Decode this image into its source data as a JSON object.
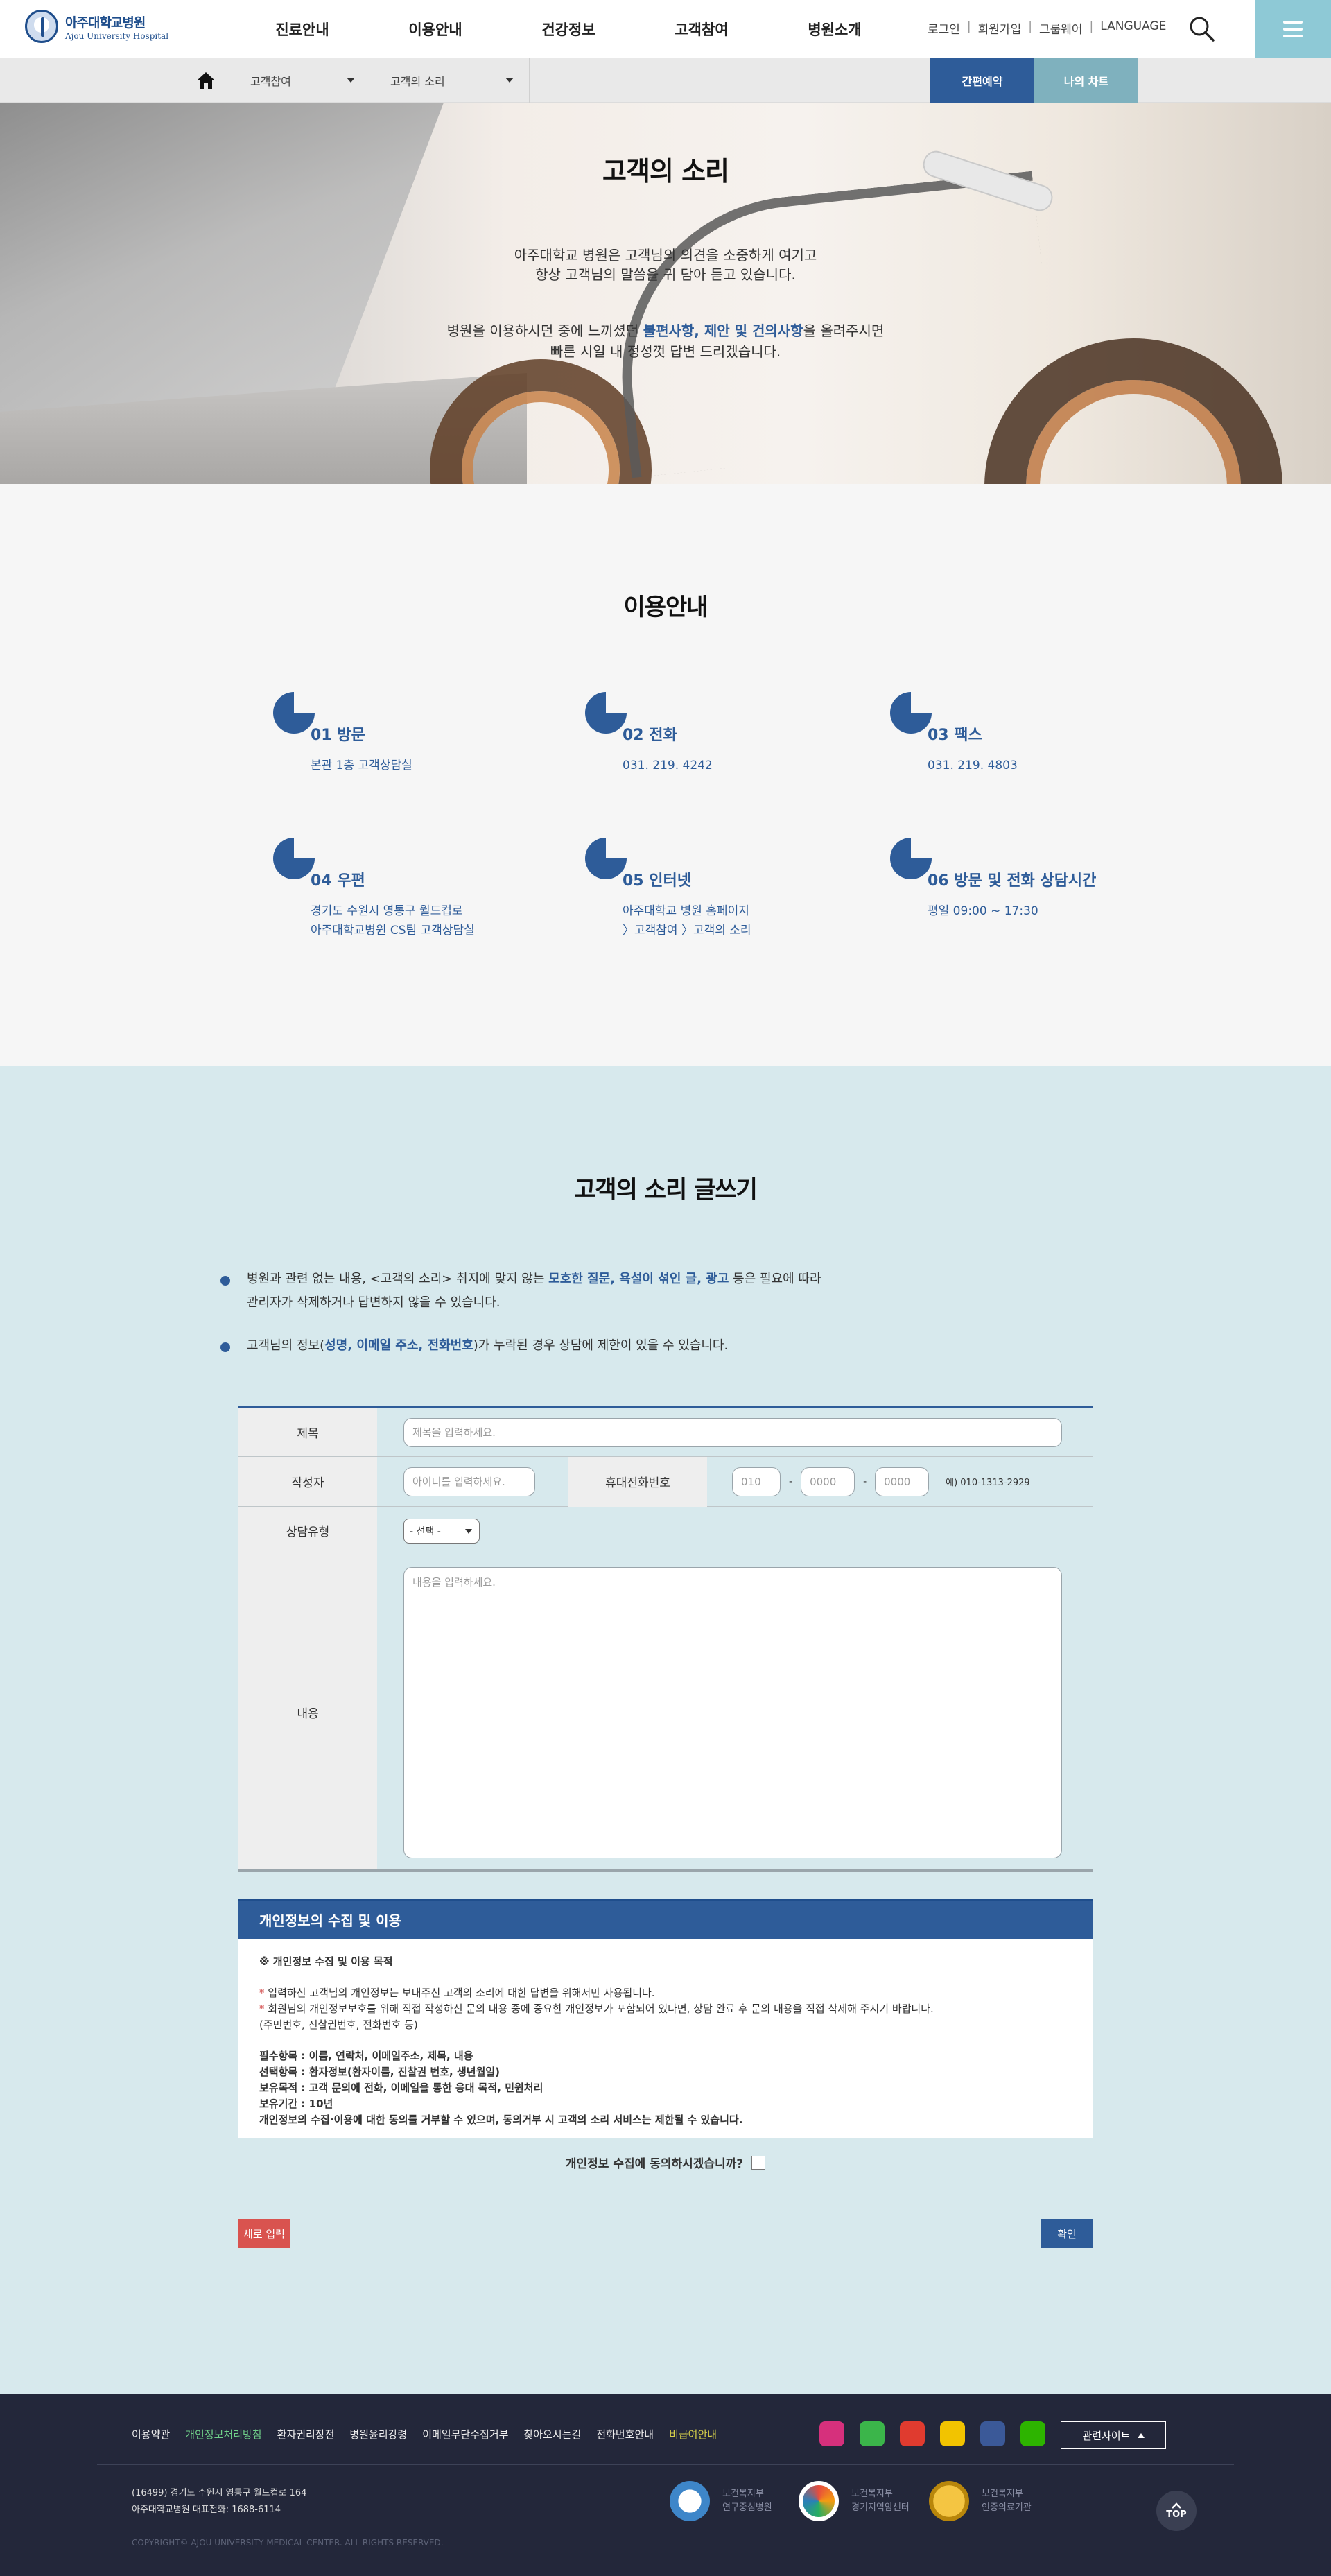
{
  "header": {
    "logo_ko": "아주대학교병원",
    "logo_en": "Ajou University Hospital",
    "gnb": [
      "진료안내",
      "이용안내",
      "건강정보",
      "고객참여",
      "병원소개"
    ],
    "util": [
      "로그인",
      "회원가입",
      "그룹웨어",
      "LANGUAGE"
    ]
  },
  "subbar": {
    "crumb1": "고객참여",
    "crumb2": "고객의 소리",
    "quick_btn": "간편예약",
    "chart_btn": "나의 차트"
  },
  "hero": {
    "title": "고객의 소리",
    "p1_line1": "아주대학교 병원은 고객님의 의견을 소중하게 여기고",
    "p1_line2": "항상 고객님의 말씀을 귀 담아 듣고 있습니다.",
    "p2_pre": "병원을 이용하시던 중에 느끼셨던 ",
    "p2_hl": "불편사항, 제안 및 건의사항",
    "p2_post": "을 올려주시면",
    "p2_line2": "빠른 시일 내 정성껏 답변 드리겠습니다."
  },
  "usage": {
    "title": "이용안내",
    "items": [
      {
        "title": "01 방문",
        "desc1": "본관 1층 고객상담실",
        "desc2": ""
      },
      {
        "title": "02 전화",
        "desc1": "031. 219. 4242",
        "desc2": ""
      },
      {
        "title": "03 팩스",
        "desc1": "031. 219. 4803",
        "desc2": ""
      },
      {
        "title": "04 우편",
        "desc1": "경기도 수원시 영통구 월드컵로",
        "desc2": "아주대학교병원 CS팀 고객상담실"
      },
      {
        "title": "05 인터넷",
        "desc1": "아주대학교 병원 홈페이지",
        "desc2": "〉고객참여 〉고객의 소리"
      },
      {
        "title": "06 방문 및 전화 상담시간",
        "desc1": "평일 09:00 ~ 17:30",
        "desc2": ""
      }
    ]
  },
  "write": {
    "title": "고객의 소리 글쓰기",
    "notice1_a": "병원과 관련 없는 내용, <고객의 소리> 취지에 맞지 않는 ",
    "notice1_hl": "모호한 질문, 욕설이 섞인 글, 광고",
    "notice1_b": " 등은 필요에 따라",
    "notice1_line2": "관리자가 삭제하거나 답변하지 않을 수 있습니다.",
    "notice2_a": "고객님의 정보(",
    "notice2_hl": "성명, 이메일 주소, 전화번호",
    "notice2_b": ")가 누락된 경우 상담에 제한이 있을 수 있습니다.",
    "labels": {
      "subject": "제목",
      "author": "작성자",
      "phone": "휴대전화번호",
      "type": "상담유형",
      "content": "내용"
    },
    "placeholders": {
      "subject": "제목을 입력하세요.",
      "author": "아이디를 입력하세요.",
      "phone1": "010",
      "phone2": "0000",
      "phone3": "0000",
      "content": "내용을 입력하세요."
    },
    "phone_example": "예) 010-1313-2929",
    "dash": "-",
    "type_value": "- 선택 -",
    "privacy_title": "개인정보의 수집 및 이용",
    "privacy_sub": "※ 개인정보 수집 및 이용 목적",
    "privacy_l1": "입력하신 고객님의 개인정보는 보내주신 고객의 소리에 대한 답변을 위해서만 사용됩니다.",
    "privacy_l2": "회원님의 개인정보보호를 위해 직접 작성하신 문의 내용 중에 중요한 개인정보가 포함되어 있다면, 상담 완료 후 문의 내용을 직접 삭제해 주시기 바랍니다.",
    "privacy_l3": "(주민번호, 진찰권번호, 전화번호 등)",
    "privacy_req": "필수항목 : 이름, 연락처, 이메일주소, 제목, 내용",
    "privacy_opt": "선택항목 : 환자정보(환자이름, 진찰권 번호, 생년월일)",
    "privacy_purpose": "보유목적 : 고객 문의에 전화, 이메일을 통한 응대 목적, 민원처리",
    "privacy_period": "보유기간 : 10년",
    "privacy_deny": "개인정보의 수집·이용에 대한 동의를 거부할 수 있으며, 동의거부 시 고객의 소리 서비스는 제한될 수 있습니다.",
    "agree_text": "개인정보 수집에 동의하시겠습니까?",
    "btn_reset": "새로 입력",
    "btn_ok": "확인"
  },
  "footer": {
    "links": [
      "이용약관",
      "개인정보처리방침",
      "환자권리장전",
      "병원윤리강령",
      "이메일무단수집거부",
      "찾아오시는길",
      "전화번호안내",
      "비급여안내"
    ],
    "related": "관련사이트",
    "addr1": "(16499) 경기도 수원시 영통구 월드컵로 164",
    "addr2": "아주대학교병원 대표전화: 1688-6114",
    "copyright": "COPYRIGHT© AJOU UNIVERSITY MEDICAL CENTER. ALL RIGHTS RESERVED.",
    "cert1_a": "보건복지부",
    "cert1_b": "연구중심병원",
    "cert2_a": "보건복지부",
    "cert2_b": "경기지역암센터",
    "cert3_a": "보건복지부",
    "cert3_b": "인증의료기관",
    "top": "TOP",
    "sns_colors": {
      "instagram": "#d6307c",
      "kakao": "#3bb54a",
      "youtube": "#e03b2f",
      "kakaostory": "#f2c300",
      "facebook": "#3b5998",
      "blog": "#2db400"
    }
  }
}
